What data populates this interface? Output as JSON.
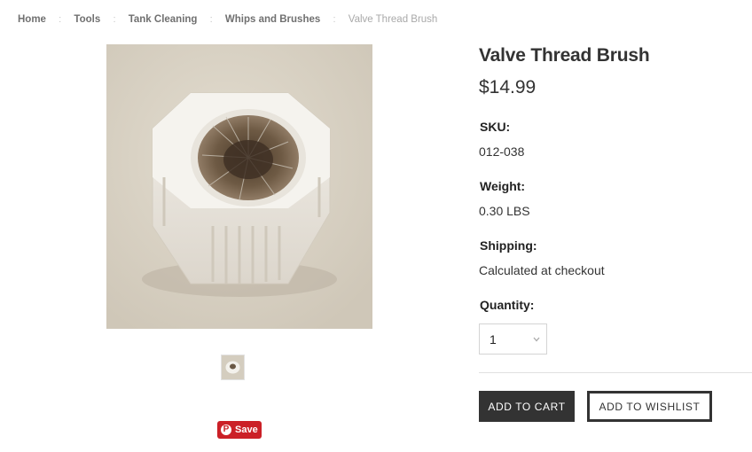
{
  "breadcrumb": {
    "items": [
      "Home",
      "Tools",
      "Tank Cleaning",
      "Whips and Brushes"
    ],
    "current": "Valve Thread Brush",
    "separator": ":"
  },
  "product": {
    "title": "Valve Thread Brush",
    "price": "$14.99",
    "sku_label": "SKU:",
    "sku": "012-038",
    "weight_label": "Weight:",
    "weight": "0.30 LBS",
    "shipping_label": "Shipping:",
    "shipping": "Calculated at checkout",
    "quantity_label": "Quantity:",
    "quantity": "1"
  },
  "buttons": {
    "add_to_cart": "ADD TO CART",
    "add_to_wishlist": "ADD TO WISHLIST",
    "pin_save": "Save"
  },
  "colors": {
    "dark_button": "#333333",
    "pinterest_red": "#cb2027",
    "image_background": "#d8d1c3"
  },
  "icons": {
    "pin": "pinterest-icon",
    "quantity_dropdown": "chevron-down-icon"
  }
}
